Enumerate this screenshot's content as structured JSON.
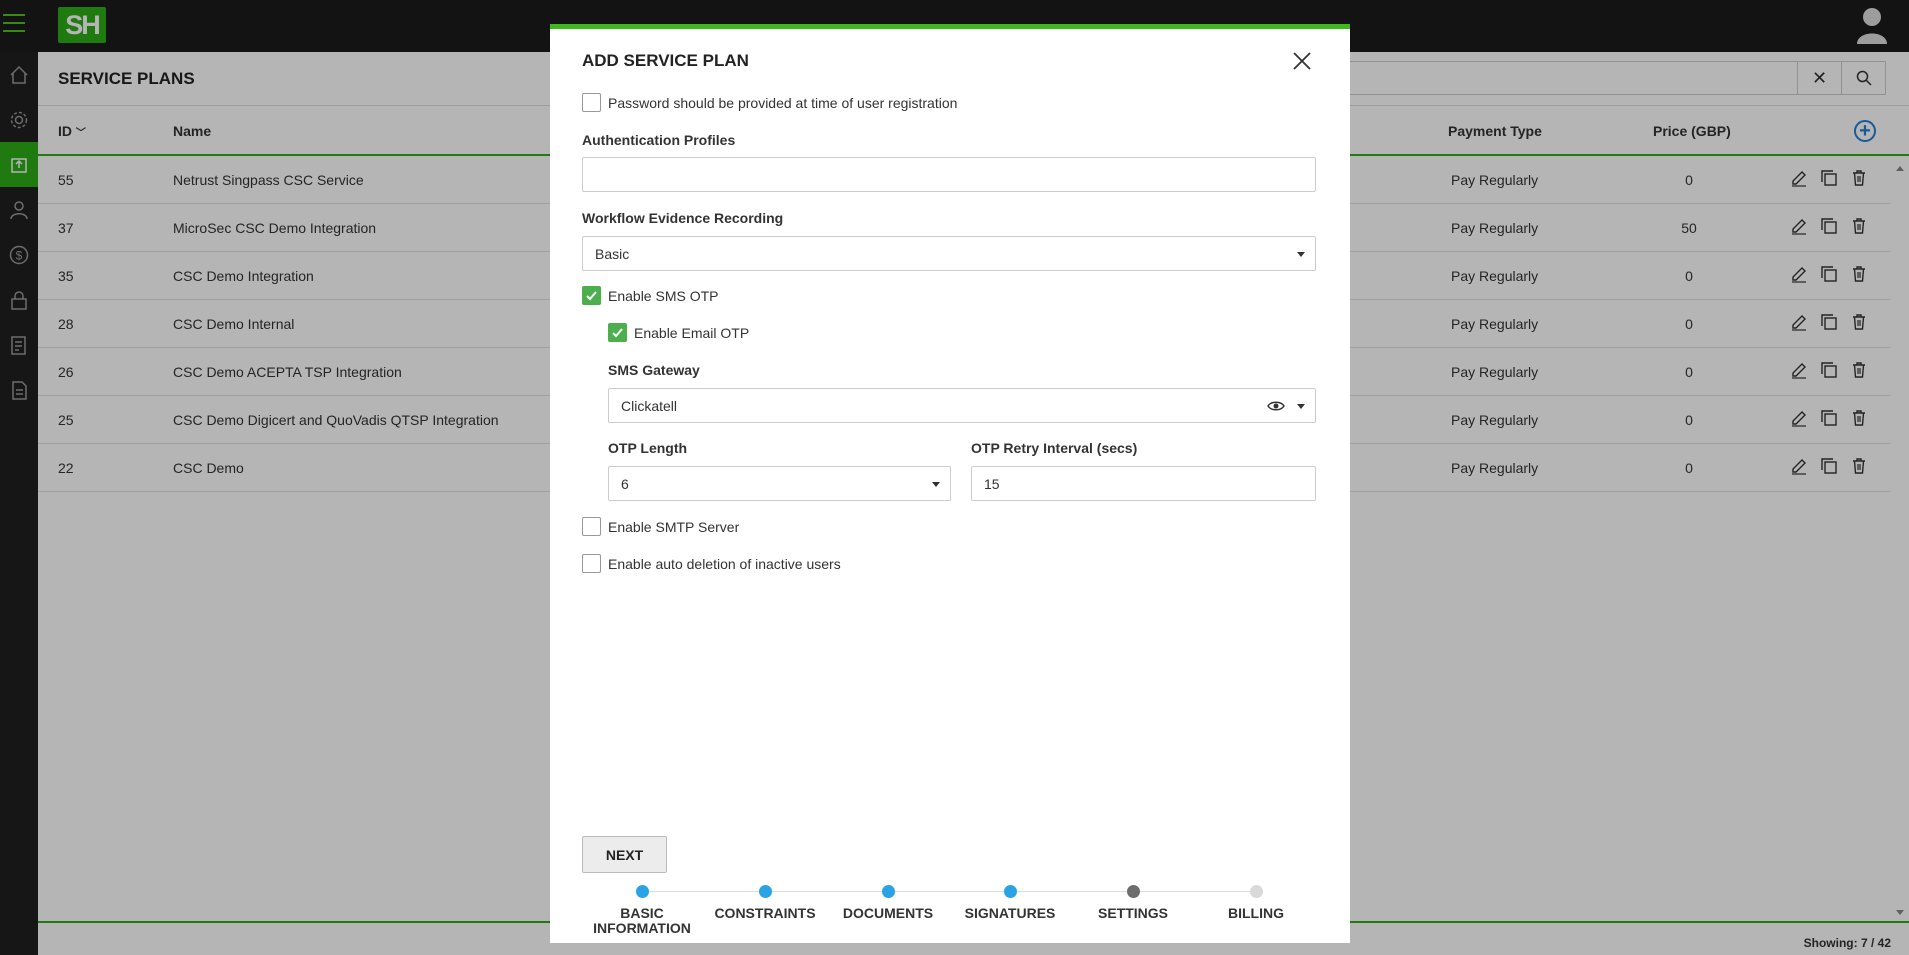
{
  "app": {
    "logo_text": "SH"
  },
  "page": {
    "title": "SERVICE PLANS",
    "showing": "Showing: 7 / 42"
  },
  "table": {
    "columns": {
      "id": "ID",
      "name": "Name",
      "payment_type": "Payment Type",
      "price": "Price (GBP)"
    },
    "rows": [
      {
        "id": "55",
        "name": "Netrust Singpass CSC Service",
        "payment": "Pay Regularly",
        "price": "0"
      },
      {
        "id": "37",
        "name": "MicroSec CSC Demo Integration",
        "payment": "Pay Regularly",
        "price": "50"
      },
      {
        "id": "35",
        "name": "CSC Demo Integration",
        "payment": "Pay Regularly",
        "price": "0"
      },
      {
        "id": "28",
        "name": "CSC Demo Internal",
        "payment": "Pay Regularly",
        "price": "0"
      },
      {
        "id": "26",
        "name": "CSC Demo ACEPTA TSP Integration",
        "payment": "Pay Regularly",
        "price": "0"
      },
      {
        "id": "25",
        "name": "CSC Demo Digicert and QuoVadis QTSP Integration",
        "payment": "Pay Regularly",
        "price": "0"
      },
      {
        "id": "22",
        "name": "CSC Demo",
        "payment": "Pay Regularly",
        "price": "0"
      }
    ]
  },
  "modal": {
    "title": "ADD SERVICE PLAN",
    "password_at_registration": {
      "label": "Password should be provided at time of user registration",
      "checked": false
    },
    "auth_profiles": {
      "label": "Authentication Profiles",
      "value": ""
    },
    "workflow_evidence": {
      "label": "Workflow Evidence Recording",
      "value": "Basic"
    },
    "enable_sms_otp": {
      "label": "Enable SMS OTP",
      "checked": true
    },
    "enable_email_otp": {
      "label": "Enable Email OTP",
      "checked": true
    },
    "sms_gateway": {
      "label": "SMS Gateway",
      "value": "Clickatell"
    },
    "otp_length": {
      "label": "OTP Length",
      "value": "6"
    },
    "otp_retry": {
      "label": "OTP Retry Interval (secs)",
      "value": "15"
    },
    "enable_smtp": {
      "label": "Enable SMTP Server",
      "checked": false
    },
    "auto_deletion": {
      "label": "Enable auto deletion of inactive users",
      "checked": false
    },
    "next_label": "NEXT",
    "steps": [
      {
        "line1": "BASIC",
        "line2": "INFORMATION",
        "color": "#29a3e6"
      },
      {
        "line1": "CONSTRAINTS",
        "line2": "",
        "color": "#29a3e6"
      },
      {
        "line1": "DOCUMENTS",
        "line2": "",
        "color": "#29a3e6"
      },
      {
        "line1": "SIGNATURES",
        "line2": "",
        "color": "#29a3e6"
      },
      {
        "line1": "SETTINGS",
        "line2": "",
        "color": "#6d6d6d"
      },
      {
        "line1": "BILLING",
        "line2": "",
        "color": "#d9d9d9"
      }
    ]
  },
  "colors": {
    "accent": "#2dac17",
    "link": "#1e7fd8",
    "checkbox": "#4cae4c"
  },
  "icons": {
    "sidebar": [
      "home-icon",
      "settings-icon",
      "service-plans-icon",
      "users-icon",
      "billing-icon",
      "lock-icon",
      "reports-icon",
      "documents-icon"
    ]
  }
}
